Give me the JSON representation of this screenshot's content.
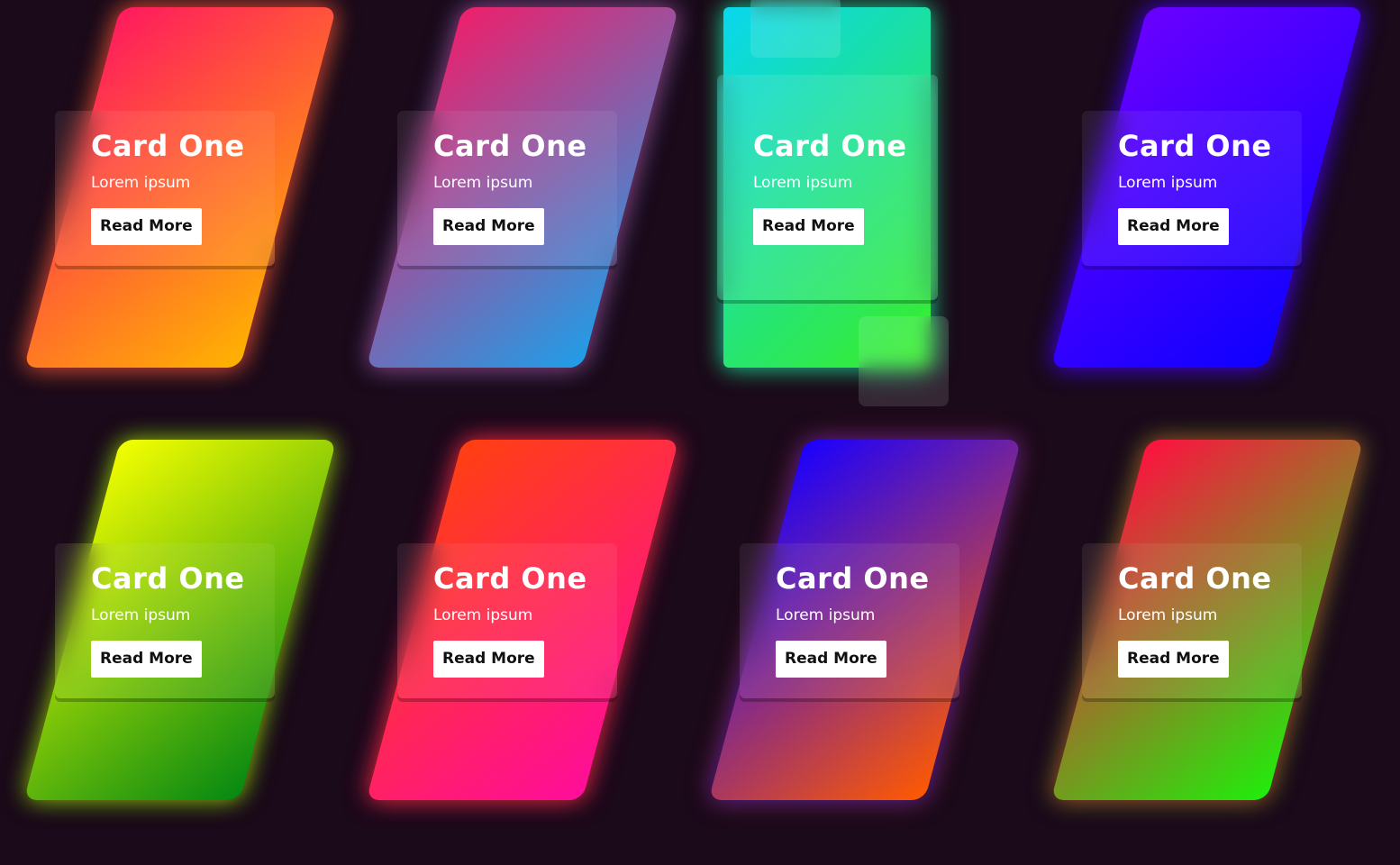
{
  "cards": [
    {
      "title": "Card One",
      "subtitle": "Lorem ipsum",
      "button": "Read More",
      "gradient": [
        "#ff1a5e",
        "#ffb300"
      ]
    },
    {
      "title": "Card One",
      "subtitle": "Lorem ipsum",
      "button": "Read More",
      "gradient": [
        "#ee1f6b",
        "#1f9ee8"
      ]
    },
    {
      "title": "Card One",
      "subtitle": "Lorem ipsum",
      "button": "Read More",
      "gradient": [
        "#08d7ef",
        "#39ee26"
      ]
    },
    {
      "title": "Card One",
      "subtitle": "Lorem ipsum",
      "button": "Read More",
      "gradient": [
        "#6a00ff",
        "#0e00ff"
      ]
    },
    {
      "title": "Card One",
      "subtitle": "Lorem ipsum",
      "button": "Read More",
      "gradient": [
        "#f4ff00",
        "#048812"
      ]
    },
    {
      "title": "Card One",
      "subtitle": "Lorem ipsum",
      "button": "Read More",
      "gradient": [
        "#ff4010",
        "#ff0d9a"
      ]
    },
    {
      "title": "Card One",
      "subtitle": "Lorem ipsum",
      "button": "Read More",
      "gradient": [
        "#1a00ff",
        "#ff5a00"
      ]
    },
    {
      "title": "Card One",
      "subtitle": "Lorem ipsum",
      "button": "Read More",
      "gradient": [
        "#ff1040",
        "#1fee0b"
      ]
    }
  ],
  "colors": {
    "background": "#1b0a1a",
    "button_bg": "#ffffff",
    "button_text": "#111111"
  }
}
